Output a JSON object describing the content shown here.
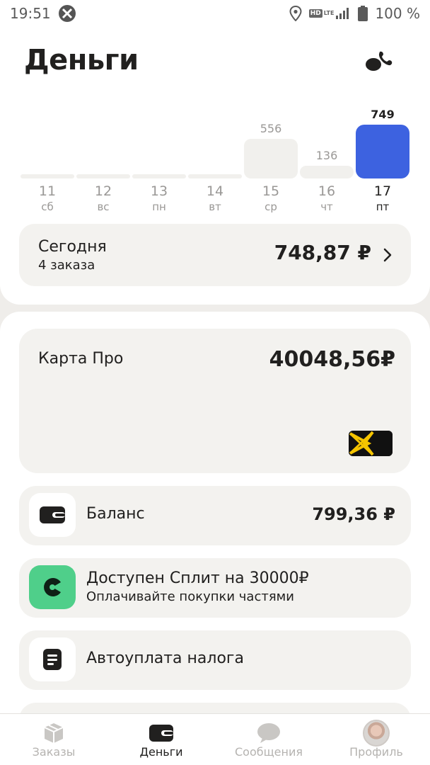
{
  "status_bar": {
    "time": "19:51",
    "battery": "100 %",
    "hd": "HD",
    "lte": "LTE"
  },
  "header": {
    "title": "Деньги",
    "support_icon": "phone-chat-icon"
  },
  "week": {
    "days": [
      {
        "num": "11",
        "name": "сб",
        "value": "",
        "amount": 0
      },
      {
        "num": "12",
        "name": "вс",
        "value": "",
        "amount": 0
      },
      {
        "num": "13",
        "name": "пн",
        "value": "",
        "amount": 0
      },
      {
        "num": "14",
        "name": "вт",
        "value": "",
        "amount": 0
      },
      {
        "num": "15",
        "name": "ср",
        "value": "556",
        "amount": 556
      },
      {
        "num": "16",
        "name": "чт",
        "value": "136",
        "amount": 136
      },
      {
        "num": "17",
        "name": "пт",
        "value": "749",
        "amount": 749
      }
    ],
    "selected_index": 6,
    "selected_color": "#3d62e0"
  },
  "today": {
    "title": "Сегодня",
    "subtitle": "4 заказа",
    "amount": "748,87 ₽"
  },
  "card_pro": {
    "title": "Карта Про",
    "amount": "40048,56₽",
    "logo_icon": "yandex-pro-card-logo"
  },
  "rows": {
    "balance": {
      "title": "Баланс",
      "amount": "799,36 ₽",
      "icon": "wallet-icon"
    },
    "split": {
      "title": "Доступен Сплит на 30000₽",
      "subtitle": "Оплачивайте покупки частями",
      "icon": "split-icon",
      "icon_bg": "#4fcf8a"
    },
    "autopay": {
      "title": "Автоуплата налога",
      "icon": "document-icon"
    }
  },
  "tabs": [
    {
      "label": "Заказы",
      "icon": "box-icon",
      "active": false
    },
    {
      "label": "Деньги",
      "icon": "wallet-icon",
      "active": true
    },
    {
      "label": "Сообщения",
      "icon": "chat-bubble-icon",
      "active": false
    },
    {
      "label": "Профиль",
      "icon": "avatar",
      "active": false
    }
  ]
}
